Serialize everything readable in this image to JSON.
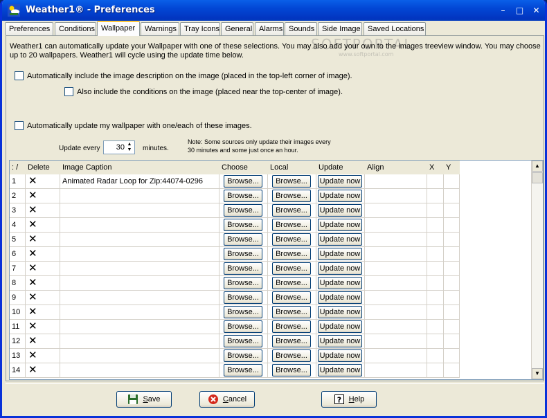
{
  "window": {
    "title": "Weather1® - Preferences",
    "minimize_glyph": "–",
    "maximize_glyph": "□",
    "close_glyph": "✕"
  },
  "tabs": [
    {
      "label": "Preferences"
    },
    {
      "label": "Conditions"
    },
    {
      "label": "Wallpaper"
    },
    {
      "label": "Warnings"
    },
    {
      "label": "Tray Icons"
    },
    {
      "label": "General"
    },
    {
      "label": "Alarms"
    },
    {
      "label": "Sounds"
    },
    {
      "label": "Side Image"
    },
    {
      "label": "Saved Locations"
    }
  ],
  "active_tab": "Wallpaper",
  "watermark": {
    "text": "SOFTPORTAL",
    "small": "www.softportal.com"
  },
  "wallpaper": {
    "intro": "Weather1 can automatically update your Wallpaper with one of these selections.  You may also add your own to the images treeview window.  You may choose up to 20 wallpapers.  Weather1 will cycle using the update time below.",
    "chk_include_desc": {
      "label": "Automatically include the image description on the image  (placed in the top-left corner of image).",
      "checked": false
    },
    "chk_include_cond": {
      "label": "Also include the conditions on the image  (placed near the top-center of image).",
      "checked": false
    },
    "chk_auto_update": {
      "label": "Automatically update my wallpaper with one/each of these images.",
      "checked": false
    },
    "update_every_label": "Update every",
    "update_every_value": "30",
    "minutes_label": "minutes.",
    "note_line1": "Note:  Some sources only update their images every",
    "note_line2": "30 minutes and some just once an hour."
  },
  "grid": {
    "headers": {
      "num": ": /",
      "delete": "Delete",
      "caption": "Image Caption",
      "choose": "Choose",
      "local": "Local",
      "update": "Update",
      "align": "Align",
      "x": "X",
      "y": "Y"
    },
    "browse_label": "Browse...",
    "update_label": "Update now",
    "delete_glyph": "✕",
    "rows": [
      {
        "num": "1",
        "caption": "Animated Radar Loop for Zip:44074-0296"
      },
      {
        "num": "2",
        "caption": ""
      },
      {
        "num": "3",
        "caption": ""
      },
      {
        "num": "4",
        "caption": ""
      },
      {
        "num": "5",
        "caption": ""
      },
      {
        "num": "6",
        "caption": ""
      },
      {
        "num": "7",
        "caption": ""
      },
      {
        "num": "8",
        "caption": ""
      },
      {
        "num": "9",
        "caption": ""
      },
      {
        "num": "10",
        "caption": ""
      },
      {
        "num": "11",
        "caption": ""
      },
      {
        "num": "12",
        "caption": ""
      },
      {
        "num": "13",
        "caption": ""
      },
      {
        "num": "14",
        "caption": ""
      }
    ]
  },
  "footer": {
    "save": "Save",
    "cancel": "Cancel",
    "help": "Help"
  }
}
